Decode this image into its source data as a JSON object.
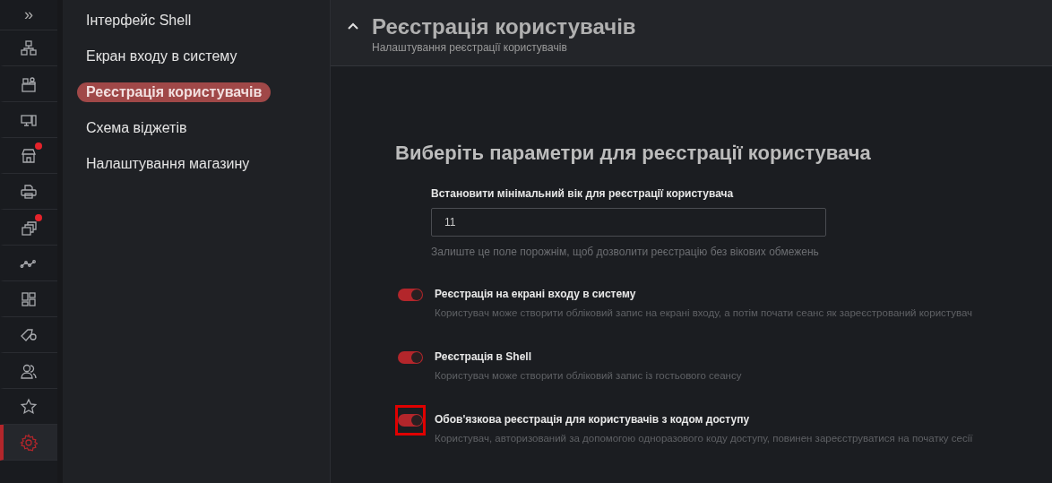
{
  "rail": {
    "expand": "»",
    "items": [
      {
        "badge": false,
        "selected": false
      },
      {
        "badge": false,
        "selected": false
      },
      {
        "badge": false,
        "selected": false
      },
      {
        "badge": true,
        "selected": false
      },
      {
        "badge": false,
        "selected": false
      },
      {
        "badge": true,
        "selected": false
      },
      {
        "badge": false,
        "selected": false
      },
      {
        "badge": false,
        "selected": false
      },
      {
        "badge": false,
        "selected": false
      },
      {
        "badge": false,
        "selected": false
      },
      {
        "badge": false,
        "selected": false
      },
      {
        "badge": false,
        "selected": true
      }
    ]
  },
  "submenu": [
    {
      "label": "Інтерфейс Shell",
      "selected": false
    },
    {
      "label": "Екран входу в систему",
      "selected": false
    },
    {
      "label": "Реєстрація користувачів",
      "selected": true
    },
    {
      "label": "Схема віджетів",
      "selected": false
    },
    {
      "label": "Налаштування магазину",
      "selected": false
    }
  ],
  "panel": {
    "title": "Реєстрація користувачів",
    "subtitle": "Налаштування реєстрації користувачів",
    "expanded": true
  },
  "section_title": "Виберіть параметри для реєстрації користувача",
  "min_age": {
    "label": "Встановити мінімальний вік для реєстрації користувача",
    "value": "11",
    "hint": "Залиште це поле порожнім, щоб дозволити реєстрацію без вікових обмежень"
  },
  "options": [
    {
      "label": "Реєстрація на екрані входу в систему",
      "description": "Користувач може створити обліковий запис на екрані входу, а потім почати сеанс як зареєстрований користувач",
      "on": true,
      "highlighted": false
    },
    {
      "label": "Реєстрація в Shell",
      "description": "Користувач може створити обліковий запис із гостьового сеансу",
      "on": true,
      "highlighted": false
    },
    {
      "label": "Обов'язкова реєстрація для користувачів з кодом доступу",
      "description": "Користувач, авторизований за допомогою одноразового коду доступу, повинен зареєструватися на початку сесії",
      "on": true,
      "highlighted": true
    }
  ]
}
